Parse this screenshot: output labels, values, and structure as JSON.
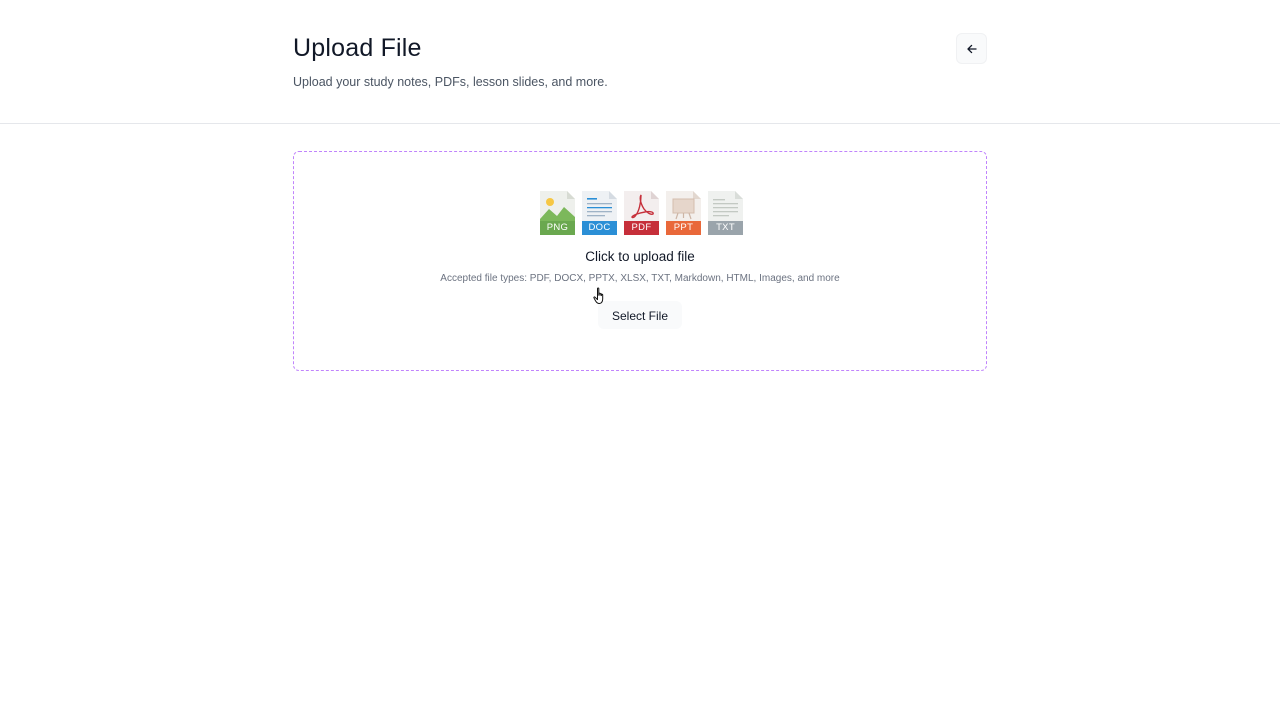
{
  "header": {
    "title": "Upload File",
    "subtitle": "Upload your study notes, PDFs, lesson slides, and more.",
    "back_icon": "arrow-left-icon"
  },
  "dropzone": {
    "file_types": [
      {
        "label": "PNG",
        "icon": "image-file-icon",
        "color": "#6aa84f"
      },
      {
        "label": "DOC",
        "icon": "doc-file-icon",
        "color": "#2b8fd6"
      },
      {
        "label": "PDF",
        "icon": "pdf-file-icon",
        "color": "#c62f3a"
      },
      {
        "label": "PPT",
        "icon": "ppt-file-icon",
        "color": "#e9683a"
      },
      {
        "label": "TXT",
        "icon": "txt-file-icon",
        "color": "#9aa4ab"
      }
    ],
    "title": "Click to upload file",
    "accepted_types": "Accepted file types: PDF, DOCX, PPTX, XLSX, TXT, Markdown, HTML, Images, and more",
    "select_button": "Select File",
    "border_color": "#c084fc"
  }
}
